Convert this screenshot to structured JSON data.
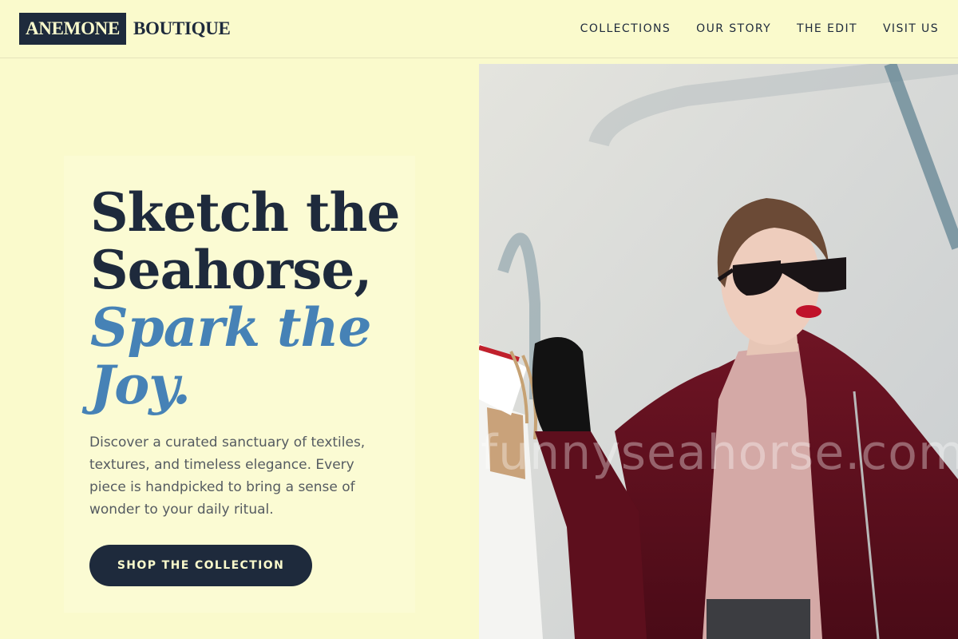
{
  "brand": {
    "logo_box": "ANEMONE",
    "logo_text": "BOUTIQUE"
  },
  "nav": {
    "items": [
      "COLLECTIONS",
      "OUR STORY",
      "THE EDIT",
      "VISIT US"
    ]
  },
  "hero": {
    "headline_line1": "Sketch the",
    "headline_line2": "Seahorse,",
    "headline_accent_line1": "Spark the",
    "headline_accent_line2": "Joy.",
    "description": "Discover a curated sanctuary of textiles, textures, and timeless elegance. Every piece is handpicked to bring a sense of wonder to your daily ritual.",
    "cta_label": "SHOP THE COLLECTION"
  },
  "photo": {
    "watermark": "funnyseahorse.com"
  },
  "colors": {
    "background": "#fafacc",
    "navy": "#1e2a3c",
    "accent_blue": "#4682b6",
    "body_text": "#555b61"
  }
}
